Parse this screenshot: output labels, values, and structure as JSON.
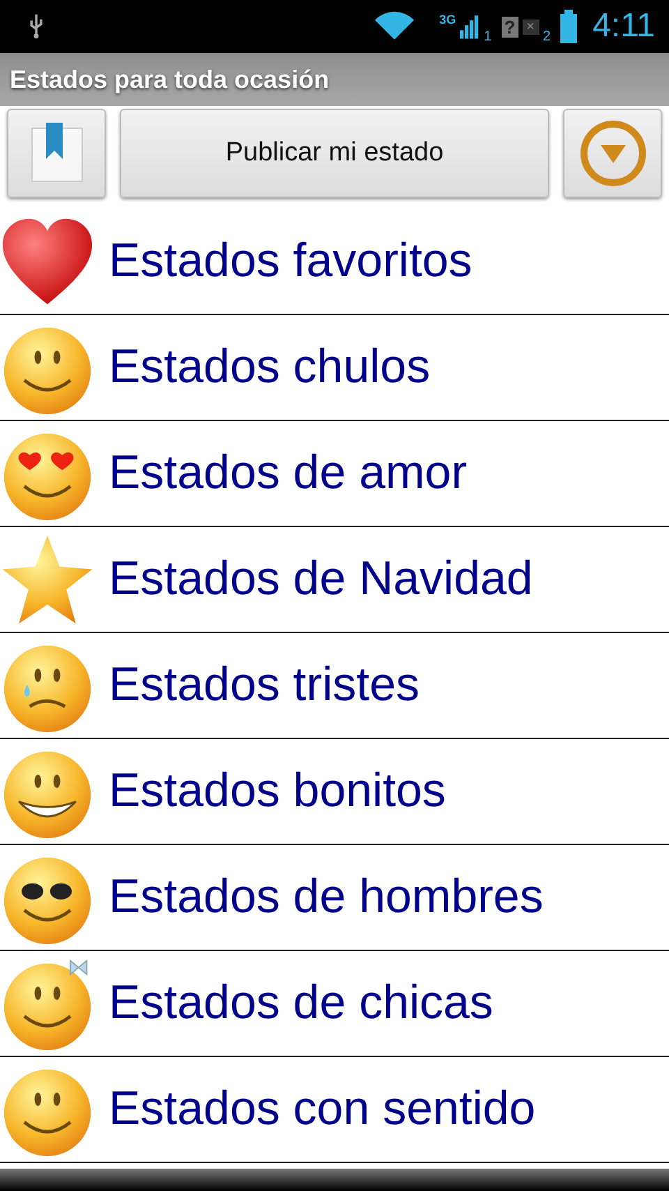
{
  "status_bar": {
    "network_1": "3G",
    "slot_1": "1",
    "sim_2": "?",
    "sim_2_mark": "×",
    "slot_2": "2",
    "time": "4:11"
  },
  "title_bar": {
    "title": "Estados para toda ocasión"
  },
  "toolbar": {
    "publish_button": "Publicar mi estado"
  },
  "categories": [
    {
      "label": "Estados favoritos",
      "kind": "heart"
    },
    {
      "label": "Estados chulos",
      "kind": "smile"
    },
    {
      "label": "Estados de amor",
      "kind": "love"
    },
    {
      "label": "Estados de Navidad",
      "kind": "star"
    },
    {
      "label": "Estados tristes",
      "kind": "sad"
    },
    {
      "label": "Estados bonitos",
      "kind": "grin"
    },
    {
      "label": "Estados de hombres",
      "kind": "cool"
    },
    {
      "label": "Estados de chicas",
      "kind": "bow"
    },
    {
      "label": "Estados con sentido",
      "kind": "plain"
    }
  ]
}
